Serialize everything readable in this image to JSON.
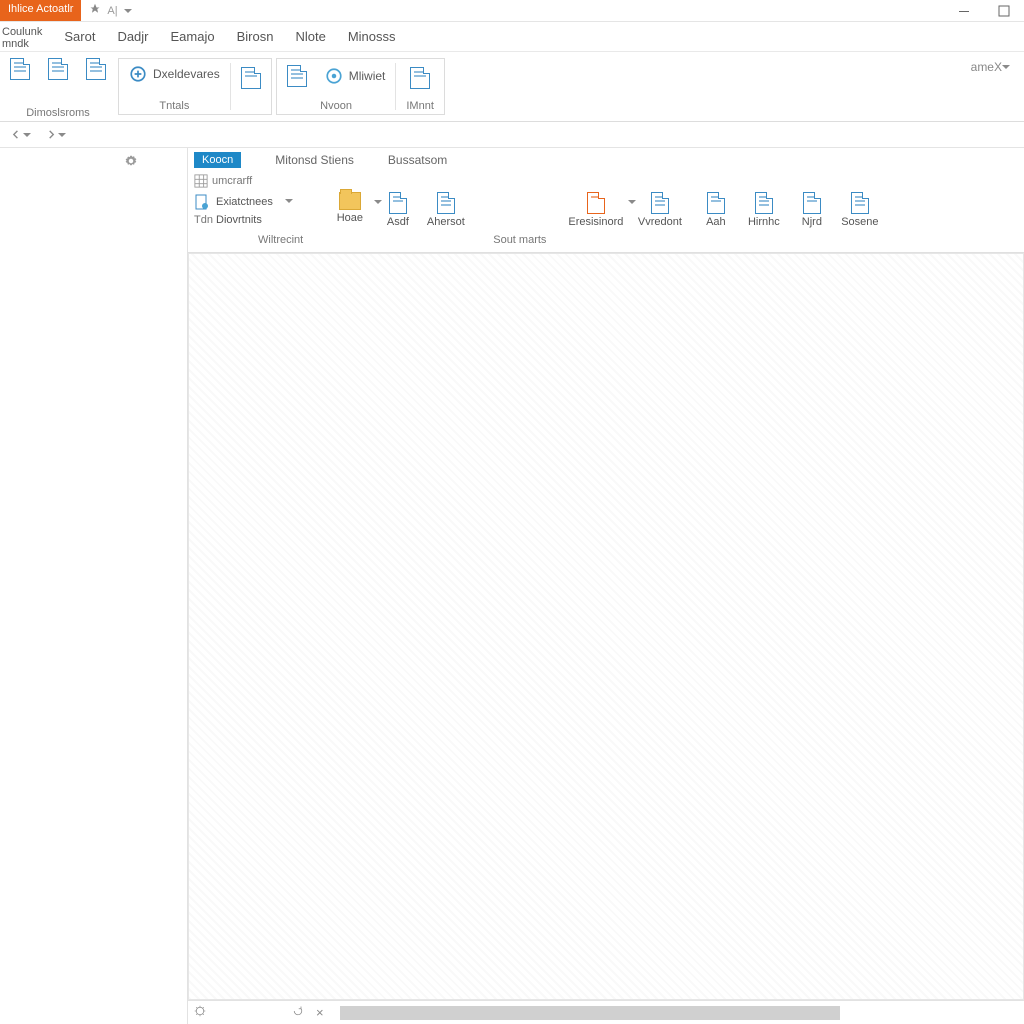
{
  "titlebar": {
    "app_name": "Ihlice Actoatlr"
  },
  "menubar": {
    "brand_top": "Coulunk",
    "brand_bottom": "mndk",
    "tabs": [
      "Sarot",
      "Dadjr",
      "Eamajo",
      "Birosn",
      "Nlote",
      "Minosss"
    ]
  },
  "ribbon": {
    "group1_caption": "Dimoslsroms",
    "group2_label": "Dxeldevares",
    "group2_caption": "Tntals",
    "group3_label": "Mliwiet",
    "group3_caption": "Nvoon",
    "group4_caption": "IMnnt",
    "right_label": "ameX"
  },
  "context": {
    "active_tab": "Koocn",
    "sub_label": "umcrarff",
    "tab2": "Mitonsd Stiens",
    "tab3": "Bussatsom"
  },
  "context_items": {
    "col_text_top": "Exiatctnees",
    "col_text_bottom": "Diovrtnits",
    "col_text_side": "Tdn",
    "home": "Hoae",
    "asd": "Asdf",
    "aherset": "Ahersot",
    "ersisnort": "Eresisinord",
    "wredont": "Vvredont",
    "aah": "Aah",
    "hinch": "Hirnhc",
    "njrd": "Njrd",
    "sosene": "Sosene"
  },
  "group_captions": {
    "left": "Wiltrecint",
    "right": "Sout marts"
  }
}
